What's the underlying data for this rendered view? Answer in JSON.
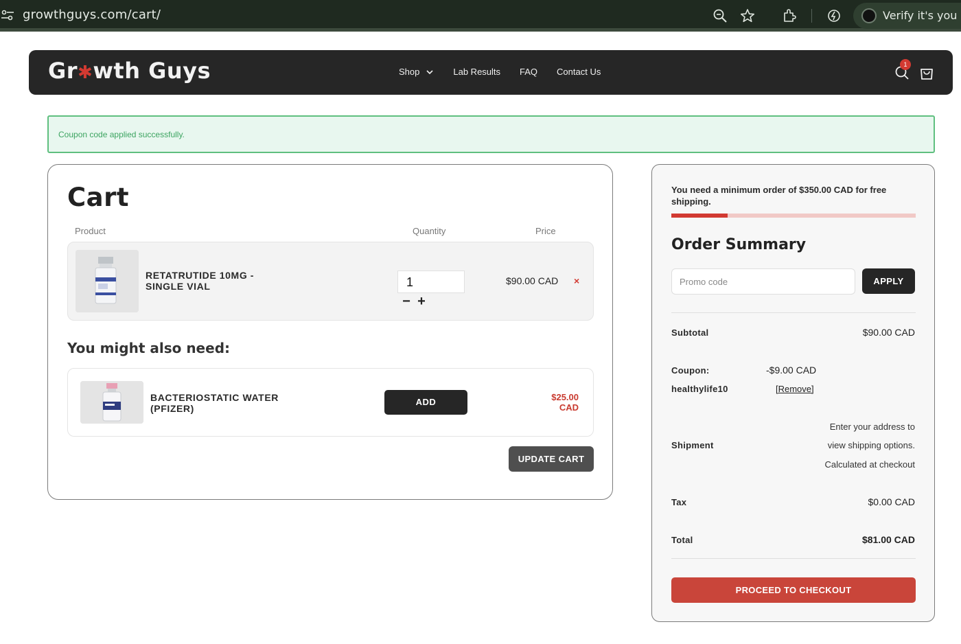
{
  "browser": {
    "url": "growthguys.com/cart/",
    "verify_label": "Verify it's you"
  },
  "header": {
    "logo_part1": "Gr",
    "logo_part2": "wth Guys",
    "nav": [
      {
        "label": "Shop"
      },
      {
        "label": "Lab Results"
      },
      {
        "label": "FAQ"
      },
      {
        "label": "Contact Us"
      }
    ],
    "cart_count": "1"
  },
  "notice": {
    "text": "Coupon code applied successfully."
  },
  "cart": {
    "title": "Cart",
    "columns": {
      "product": "Product",
      "quantity": "Quantity",
      "price": "Price"
    },
    "items": [
      {
        "name_line1": "RETATRUTIDE 10MG -",
        "name_line2": "SINGLE VIAL",
        "quantity": "1",
        "price": "$90.00 CAD",
        "remove": "×"
      }
    ],
    "qty_minus": "−",
    "qty_plus": "+",
    "upsell_title": "You might also need:",
    "upsell": {
      "name_line1": "BACTERIOSTATIC WATER",
      "name_line2": "(PFIZER)",
      "add_label": "ADD",
      "price_line1": "$25.00",
      "price_line2": "CAD"
    },
    "update_label": "UPDATE CART"
  },
  "summary": {
    "shipping_message": "You need a minimum order of $350.00 CAD for free shipping.",
    "shipping_progress": 0.23,
    "title": "Order Summary",
    "promo_placeholder": "Promo code",
    "apply_label": "APPLY",
    "subtotal_label": "Subtotal",
    "subtotal_value": "$90.00 CAD",
    "coupon_label": "Coupon:",
    "coupon_code": "healthylife10",
    "coupon_amount": "-$9.00 CAD",
    "coupon_remove": "[Remove]",
    "shipment_label": "Shipment",
    "shipment_note1": "Enter your address to",
    "shipment_note2": "view shipping options.",
    "shipment_note3": "Calculated at checkout",
    "tax_label": "Tax",
    "tax_value": "$0.00 CAD",
    "total_label": "Total",
    "total_value": "$81.00 CAD",
    "checkout_label": "PROCEED TO CHECKOUT"
  },
  "colors": {
    "brand_dark": "#262626",
    "accent_red": "#d23a32",
    "success_green": "#3ca460"
  }
}
